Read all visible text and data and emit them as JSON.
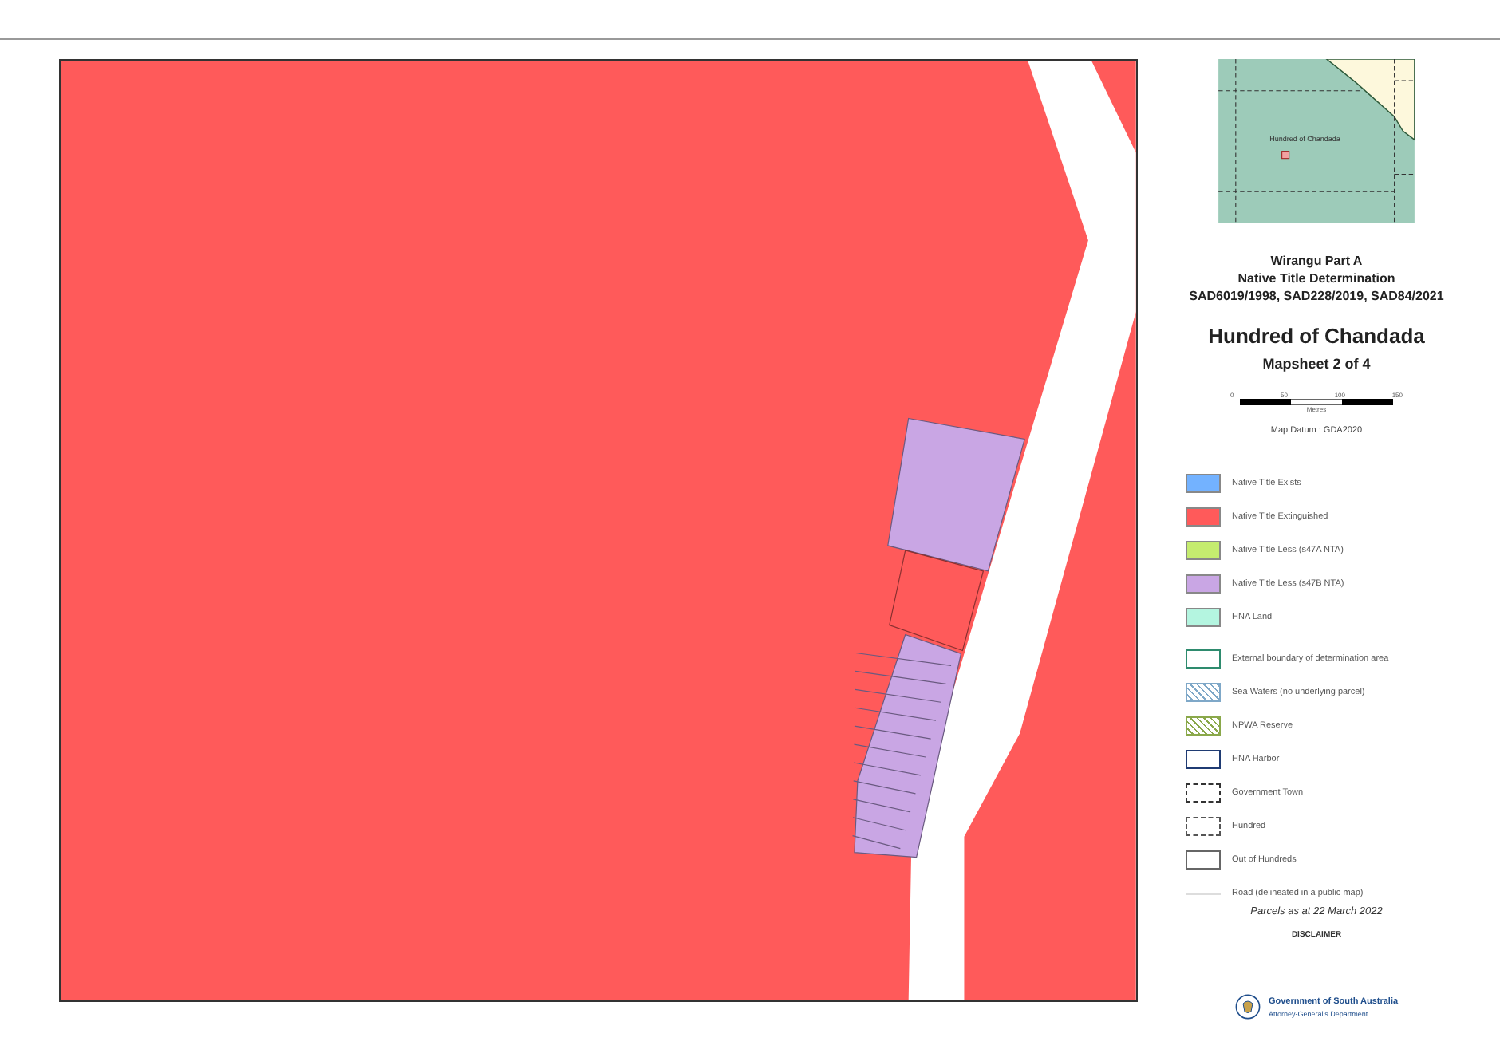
{
  "inset_map": {
    "label": "Hundred of Chandada"
  },
  "title": {
    "lines": [
      "Wirangu Part A",
      "Native Title Determination",
      "SAD6019/1998, SAD228/2019, SAD84/2021"
    ],
    "heading": "Hundred of Chandada",
    "subheading": "Mapsheet 2 of 4"
  },
  "scale_bar": {
    "ticks": [
      "0",
      "50",
      "100",
      "150"
    ],
    "unit": "Metres"
  },
  "map_datum": "Map Datum : GDA2020",
  "legend": [
    {
      "kind": "fill",
      "color": "#73b2ff",
      "label": "Native Title Exists"
    },
    {
      "kind": "fill",
      "color": "#ff5a5a",
      "label": "Native Title Extinguished"
    },
    {
      "kind": "fill",
      "color": "#c5ec6f",
      "label": "Native Title Less (s47A NTA)"
    },
    {
      "kind": "fill",
      "color": "#c9a6e4",
      "label": "Native Title Less (s47B NTA)"
    },
    {
      "kind": "fill",
      "color": "#b4f5e0",
      "label": "HNA Land"
    },
    {
      "kind": "outline",
      "color": "#2e8b6e",
      "label": "External boundary of determination area"
    },
    {
      "kind": "pattern",
      "color": "#7fa8c8",
      "label": "Sea Waters (no underlying parcel)"
    },
    {
      "kind": "pattern",
      "color": "#8aa84a",
      "label": "NPWA Reserve"
    },
    {
      "kind": "outline",
      "color": "#1f3b73",
      "label": "HNA Harbor"
    },
    {
      "kind": "dashed",
      "color": "#333333",
      "label": "Government Town"
    },
    {
      "kind": "dashed",
      "color": "#555555",
      "label": "Hundred"
    },
    {
      "kind": "outline",
      "color": "#666666",
      "label": "Out of Hundreds"
    },
    {
      "kind": "line",
      "color": "#dddddd",
      "label": "Road (delineated in a public map)"
    }
  ],
  "parcels_date": "Parcels as at 22 March 2022",
  "disclaimer": {
    "heading": "DISCLAIMER"
  },
  "logo": {
    "name": "Government of South Australia",
    "department": "Attorney-General's Department"
  }
}
